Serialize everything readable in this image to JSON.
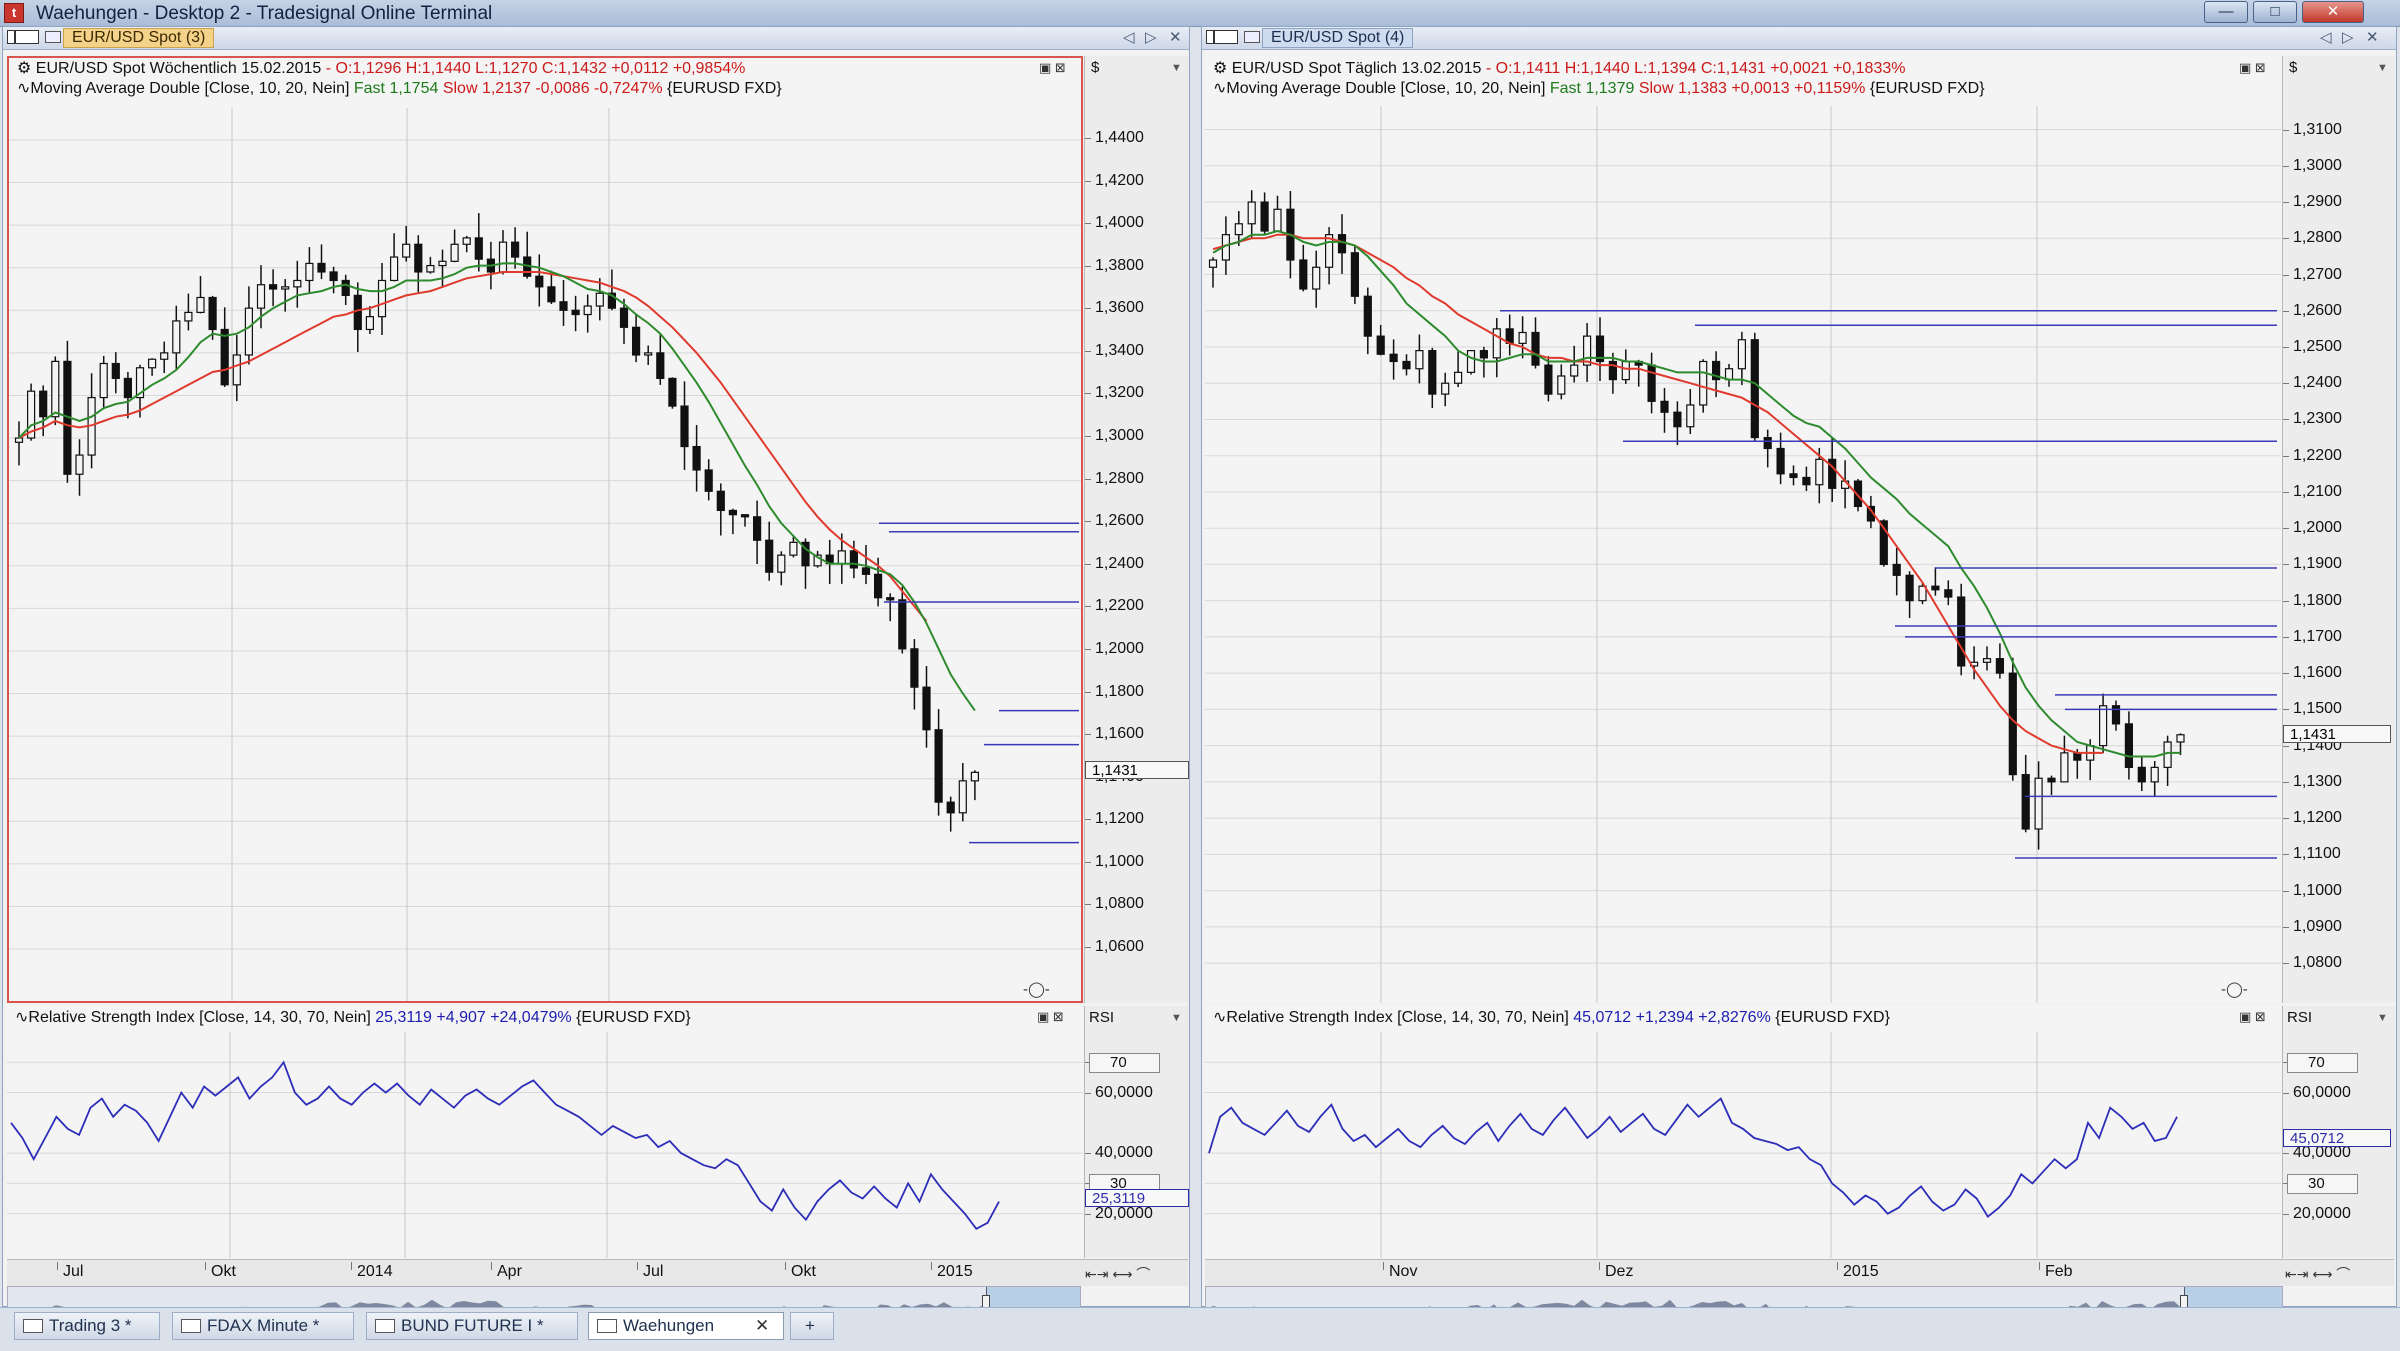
{
  "app": {
    "window_title": "Waehungen - Desktop 2 - Tradesignal Online Terminal",
    "controls": {
      "minimize": "—",
      "maximize": "□",
      "close": "✕"
    }
  },
  "left": {
    "tab_title": "EUR/USD Spot (3)",
    "price": {
      "symbol": "EUR/USD Spot Wöchentlich",
      "date": "15.02.2015",
      "ohlc": "- O:1,1296 H:1,1440 L:1,1270 C:1,1432 +0,0112 +0,9854%",
      "ma_name": "Moving Average Double [Close, 10, 20, Nein]",
      "ma_fast": "Fast 1,1754",
      "ma_slow": "Slow 1,2137 -0,0086 -0,7247%",
      "ma_source": "{EURUSD FXD}",
      "currency": "$",
      "last_tag": "1,1431",
      "ticks": [
        "1,4400",
        "1,4200",
        "1,4000",
        "1,3800",
        "1,3600",
        "1,3400",
        "1,3200",
        "1,3000",
        "1,2800",
        "1,2600",
        "1,2400",
        "1,2200",
        "1,2000",
        "1,1800",
        "1,1600",
        "1,1400",
        "1,1200",
        "1,1000",
        "1,0800",
        "1,0600"
      ],
      "ylim": [
        1.045,
        1.455
      ]
    },
    "rsi": {
      "name": "Relative Strength Index [Close, 14, 30, 70, Nein]",
      "value": "25,3119 +4,907 +24,0479%",
      "source": "{EURUSD FXD}",
      "label": "RSI",
      "ticks": [
        "70",
        "60,0000",
        "40,0000",
        "30",
        "20,0000"
      ],
      "last_tag": "25,3119",
      "series": [
        50,
        45,
        38,
        45,
        52,
        48,
        46,
        55,
        58,
        52,
        56,
        54,
        50,
        44,
        52,
        60,
        55,
        62,
        59,
        62,
        65,
        58,
        62,
        65,
        70,
        60,
        56,
        58,
        62,
        58,
        56,
        60,
        63,
        60,
        63,
        59,
        56,
        61,
        58,
        55,
        59,
        61,
        58,
        56,
        59,
        62,
        64,
        60,
        56,
        54,
        52,
        49,
        46,
        49,
        47,
        45,
        46,
        42,
        44,
        40,
        38,
        36,
        35,
        38,
        36,
        30,
        24,
        21,
        28,
        22,
        18,
        24,
        28,
        31,
        27,
        25,
        29,
        25,
        22,
        30,
        24,
        33,
        28,
        24,
        20,
        15,
        17,
        24
      ]
    },
    "x_labels": [
      "Jul",
      "Okt",
      "2014",
      "Apr",
      "Jul",
      "Okt",
      "2015"
    ],
    "weekly_close": [
      1.3,
      1.322,
      1.31,
      1.336,
      1.283,
      1.292,
      1.319,
      1.335,
      1.328,
      1.319,
      1.333,
      1.337,
      1.34,
      1.355,
      1.359,
      1.366,
      1.351,
      1.325,
      1.339,
      1.361,
      1.372,
      1.37,
      1.371,
      1.374,
      1.382,
      1.378,
      1.374,
      1.367,
      1.351,
      1.357,
      1.374,
      1.385,
      1.391,
      1.378,
      1.381,
      1.383,
      1.391,
      1.394,
      1.384,
      1.378,
      1.392,
      1.385,
      1.376,
      1.371,
      1.364,
      1.36,
      1.358,
      1.362,
      1.368,
      1.361,
      1.352,
      1.339,
      1.34,
      1.328,
      1.315,
      1.296,
      1.285,
      1.275,
      1.266,
      1.264,
      1.263,
      1.252,
      1.237,
      1.245,
      1.251,
      1.24,
      1.245,
      1.241,
      1.247,
      1.239,
      1.236,
      1.225,
      1.224,
      1.201,
      1.183,
      1.163,
      1.129,
      1.124,
      1.139,
      1.143
    ],
    "ma_fast": [
      1.3,
      1.306,
      1.308,
      1.312,
      1.31,
      1.308,
      1.31,
      1.314,
      1.316,
      1.317,
      1.321,
      1.325,
      1.328,
      1.332,
      1.338,
      1.345,
      1.349,
      1.348,
      1.349,
      1.352,
      1.357,
      1.361,
      1.364,
      1.367,
      1.368,
      1.369,
      1.371,
      1.372,
      1.37,
      1.369,
      1.369,
      1.371,
      1.374,
      1.374,
      1.374,
      1.375,
      1.377,
      1.38,
      1.381,
      1.381,
      1.382,
      1.382,
      1.381,
      1.38,
      1.378,
      1.376,
      1.373,
      1.37,
      1.369,
      1.367,
      1.363,
      1.358,
      1.354,
      1.349,
      1.342,
      1.334,
      1.326,
      1.317,
      1.307,
      1.297,
      1.287,
      1.278,
      1.268,
      1.26,
      1.254,
      1.248,
      1.244,
      1.241,
      1.241,
      1.241,
      1.24,
      1.238,
      1.236,
      1.231,
      1.223,
      1.213,
      1.201,
      1.189,
      1.18,
      1.172
    ],
    "ma_slow": [
      1.3,
      1.303,
      1.305,
      1.308,
      1.306,
      1.305,
      1.306,
      1.308,
      1.31,
      1.311,
      1.313,
      1.316,
      1.319,
      1.322,
      1.325,
      1.328,
      1.331,
      1.332,
      1.334,
      1.336,
      1.339,
      1.342,
      1.345,
      1.348,
      1.351,
      1.354,
      1.357,
      1.358,
      1.36,
      1.361,
      1.363,
      1.365,
      1.367,
      1.368,
      1.369,
      1.371,
      1.373,
      1.375,
      1.376,
      1.377,
      1.378,
      1.378,
      1.378,
      1.378,
      1.377,
      1.376,
      1.375,
      1.374,
      1.373,
      1.371,
      1.369,
      1.366,
      1.362,
      1.357,
      1.352,
      1.346,
      1.34,
      1.333,
      1.326,
      1.318,
      1.31,
      1.302,
      1.294,
      1.286,
      1.278,
      1.27,
      1.263,
      1.257,
      1.252,
      1.248,
      1.244,
      1.24,
      1.235,
      1.228,
      1.221,
      1.214
    ]
  },
  "right": {
    "tab_title": "EUR/USD Spot (4)",
    "price": {
      "symbol": "EUR/USD Spot Täglich",
      "date": "13.02.2015",
      "ohlc": "- O:1,1411 H:1,1440 L:1,1394 C:1,1431 +0,0021 +0,1833%",
      "ma_name": "Moving Average Double [Close, 10, 20, Nein]",
      "ma_fast": "Fast 1,1379",
      "ma_slow": "Slow 1,1383 +0,0013 +0,1159%",
      "ma_source": "{EURUSD FXD}",
      "currency": "$",
      "last_tag": "1,1431",
      "ticks": [
        "1,3100",
        "1,3000",
        "1,2900",
        "1,2800",
        "1,2700",
        "1,2600",
        "1,2500",
        "1,2400",
        "1,2300",
        "1,2200",
        "1,2100",
        "1,2000",
        "1,1900",
        "1,1800",
        "1,1700",
        "1,1600",
        "1,1500",
        "1,1400",
        "1,1300",
        "1,1200",
        "1,1100",
        "1,1000",
        "1,0900",
        "1,0800"
      ],
      "ylim": [
        1.0745,
        1.3165
      ]
    },
    "rsi": {
      "name": "Relative Strength Index [Close, 14, 30, 70, Nein]",
      "value": "45,0712 +1,2394 +2,8276%",
      "source": "{EURUSD FXD}",
      "label": "RSI",
      "ticks": [
        "70",
        "60,0000",
        "40,0000",
        "30",
        "20,0000"
      ],
      "last_tag": "45,0712",
      "series": [
        40,
        52,
        55,
        50,
        48,
        46,
        50,
        54,
        49,
        47,
        52,
        56,
        48,
        44,
        46,
        42,
        45,
        48,
        44,
        42,
        46,
        49,
        45,
        43,
        47,
        50,
        44,
        49,
        53,
        48,
        46,
        51,
        55,
        50,
        45,
        48,
        52,
        47,
        50,
        53,
        48,
        46,
        51,
        56,
        52,
        55,
        58,
        50,
        48,
        45,
        44,
        43,
        41,
        42,
        38,
        36,
        30,
        27,
        23,
        26,
        24,
        20,
        22,
        26,
        29,
        24,
        21,
        23,
        28,
        25,
        19,
        22,
        26,
        33,
        30,
        34,
        38,
        35,
        38,
        50,
        45,
        55,
        52,
        48,
        50,
        44,
        45,
        52
      ]
    },
    "x_labels": [
      "Nov",
      "Dez",
      "2015",
      "Feb"
    ],
    "daily_close": [
      1.274,
      1.281,
      1.284,
      1.29,
      1.282,
      1.288,
      1.274,
      1.266,
      1.272,
      1.281,
      1.276,
      1.264,
      1.253,
      1.248,
      1.246,
      1.244,
      1.249,
      1.237,
      1.24,
      1.243,
      1.249,
      1.247,
      1.255,
      1.251,
      1.254,
      1.245,
      1.237,
      1.242,
      1.245,
      1.253,
      1.246,
      1.241,
      1.246,
      1.245,
      1.235,
      1.232,
      1.228,
      1.234,
      1.246,
      1.241,
      1.244,
      1.252,
      1.225,
      1.222,
      1.215,
      1.214,
      1.212,
      1.219,
      1.211,
      1.213,
      1.206,
      1.202,
      1.19,
      1.187,
      1.18,
      1.184,
      1.183,
      1.181,
      1.162,
      1.163,
      1.164,
      1.16,
      1.132,
      1.117,
      1.131,
      1.13,
      1.138,
      1.136,
      1.14,
      1.151,
      1.146,
      1.134,
      1.13,
      1.134,
      1.141,
      1.143
    ],
    "ma_fast": [
      1.276,
      1.278,
      1.279,
      1.281,
      1.281,
      1.282,
      1.281,
      1.279,
      1.278,
      1.279,
      1.279,
      1.278,
      1.275,
      1.271,
      1.267,
      1.262,
      1.259,
      1.256,
      1.253,
      1.249,
      1.247,
      1.246,
      1.246,
      1.247,
      1.248,
      1.248,
      1.246,
      1.246,
      1.246,
      1.247,
      1.247,
      1.247,
      1.246,
      1.246,
      1.245,
      1.244,
      1.243,
      1.243,
      1.243,
      1.242,
      1.241,
      1.241,
      1.24,
      1.237,
      1.234,
      1.231,
      1.229,
      1.228,
      1.225,
      1.222,
      1.218,
      1.214,
      1.211,
      1.208,
      1.204,
      1.201,
      1.198,
      1.195,
      1.189,
      1.184,
      1.178,
      1.171,
      1.163,
      1.156,
      1.151,
      1.147,
      1.144,
      1.141,
      1.14,
      1.139,
      1.138,
      1.137,
      1.137,
      1.137,
      1.138,
      1.138
    ],
    "ma_slow": [
      1.277,
      1.278,
      1.279,
      1.28,
      1.28,
      1.281,
      1.281,
      1.28,
      1.28,
      1.28,
      1.279,
      1.278,
      1.276,
      1.274,
      1.272,
      1.269,
      1.267,
      1.264,
      1.262,
      1.259,
      1.257,
      1.255,
      1.253,
      1.251,
      1.25,
      1.248,
      1.247,
      1.247,
      1.246,
      1.246,
      1.245,
      1.245,
      1.244,
      1.244,
      1.243,
      1.242,
      1.241,
      1.24,
      1.239,
      1.238,
      1.237,
      1.236,
      1.234,
      1.232,
      1.229,
      1.226,
      1.223,
      1.22,
      1.217,
      1.213,
      1.209,
      1.205,
      1.2,
      1.195,
      1.19,
      1.185,
      1.179,
      1.173,
      1.167,
      1.161,
      1.156,
      1.151,
      1.147,
      1.144,
      1.142,
      1.14,
      1.139,
      1.138,
      1.138,
      1.138
    ]
  },
  "bottom_tabs": [
    {
      "label": "Trading 3 *"
    },
    {
      "label": "FDAX Minute *"
    },
    {
      "label": "BUND FUTURE I *"
    },
    {
      "label": "Waehungen"
    }
  ],
  "icons": {
    "add_tab": "+",
    "close_tab": "✕",
    "chart_icon": "chart-icon",
    "caret": "▼"
  },
  "colors": {
    "candle": "#111111",
    "ma_fast": "#2e8b2e",
    "ma_slow": "#e03a2e",
    "rsi": "#2d2db8",
    "hline": "#3a3ab8",
    "active_border": "#d9534f",
    "tab_title_bg": "#f4d28a"
  }
}
